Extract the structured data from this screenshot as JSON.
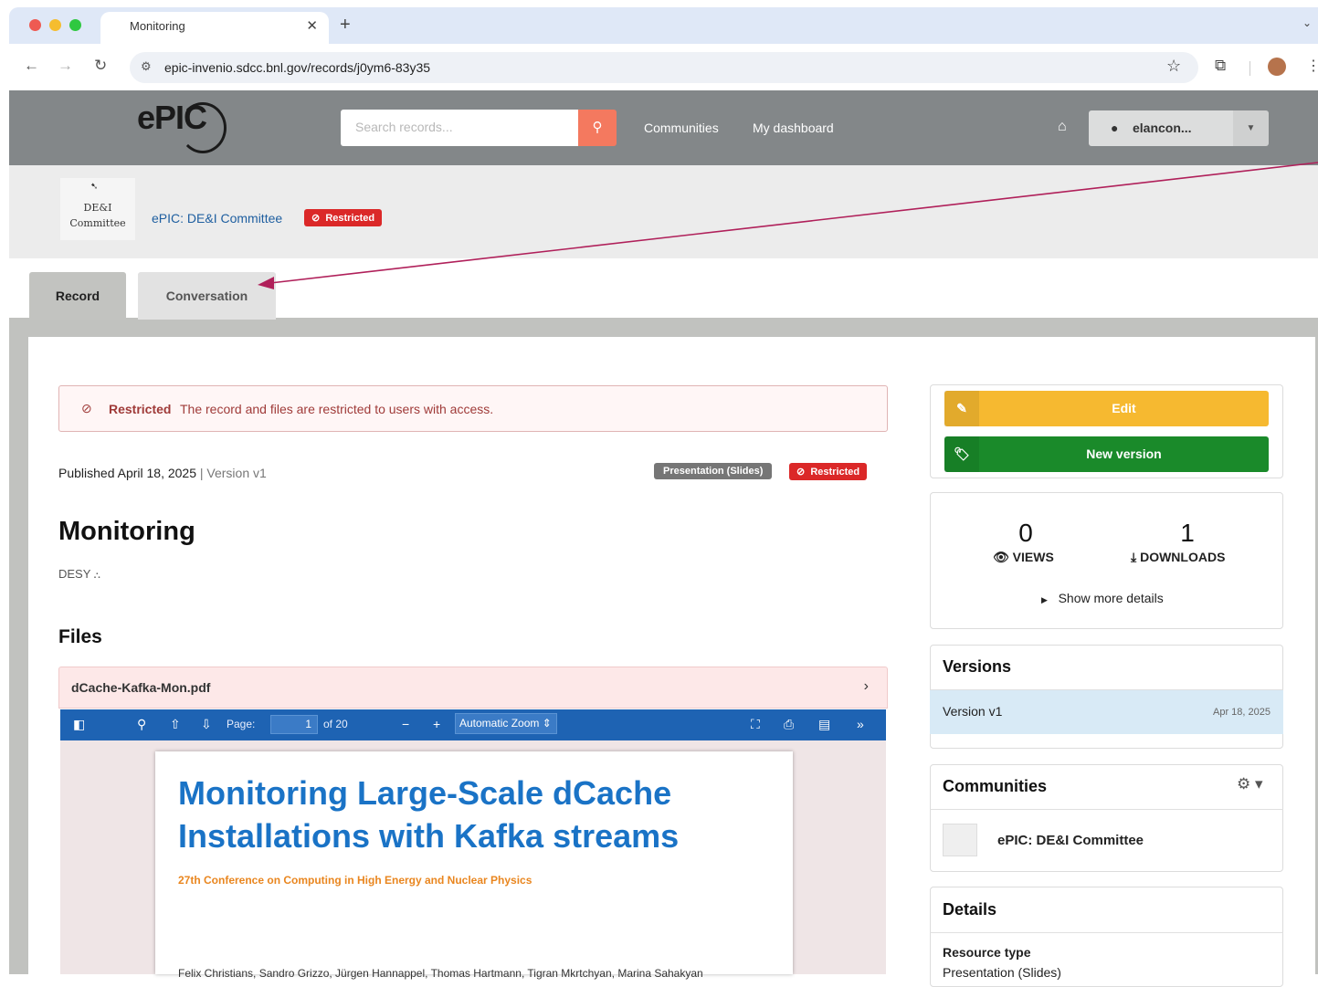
{
  "browser": {
    "tab_title": "Monitoring",
    "url": "epic-invenio.sdcc.bnl.gov/records/j0ym6-83y35"
  },
  "header": {
    "logo_text": "ePIC",
    "search_placeholder": "Search records...",
    "nav": [
      "Communities",
      "My dashboard"
    ],
    "user": "elancon..."
  },
  "community": {
    "logo_lines": [
      "DE&I",
      "Committee"
    ],
    "name": "ePIC: DE&I Committee",
    "badge": "Restricted"
  },
  "tabs": [
    "Record",
    "Conversation"
  ],
  "record": {
    "notice_bold": "Restricted",
    "notice_text": "The record and files are restricted to users with access.",
    "published": "Published April 18, 2025",
    "version_sep": " | ",
    "version": "Version v1",
    "resource_badge": "Presentation (Slides)",
    "access_badge": "Restricted",
    "title": "Monitoring",
    "creator": "DESY"
  },
  "files": {
    "heading": "Files",
    "filename": "dCache-Kafka-Mon.pdf",
    "viewer": {
      "page_label": "Page:",
      "page": "1",
      "page_of": "of 20",
      "zoom": "Automatic Zoom"
    },
    "slide": {
      "title_line1": "Monitoring Large-Scale dCache",
      "title_line2": "Installations with Kafka streams",
      "subtitle": "27th Conference on Computing in High Energy and Nuclear Physics",
      "authors": "Felix Christians, Sandro Grizzo, Jürgen Hannappel, Thomas Hartmann, Tigran Mkrtchyan, Marina Sahakyan"
    }
  },
  "sidebar": {
    "edit": "Edit",
    "new_version": "New version",
    "views_count": "0",
    "views_label": "VIEWS",
    "downloads_count": "1",
    "downloads_label": "DOWNLOADS",
    "show_more": "Show more details",
    "versions_heading": "Versions",
    "version_name": "Version v1",
    "version_date": "Apr 18, 2025",
    "communities_heading": "Communities",
    "community_name": "ePIC: DE&I Committee",
    "details_heading": "Details",
    "resource_type_label": "Resource type",
    "resource_type_value": "Presentation (Slides)"
  },
  "colors": {
    "header_bg": "#838789",
    "search_button": "#f4795f",
    "restricted_red": "#db2828",
    "edit_yellow": "#f6b930",
    "new_version_green": "#1a8a2a",
    "pdf_toolbar": "#1e63b3",
    "slide_title_blue": "#1a73c6",
    "annotation_arrow": "#b0205a"
  }
}
